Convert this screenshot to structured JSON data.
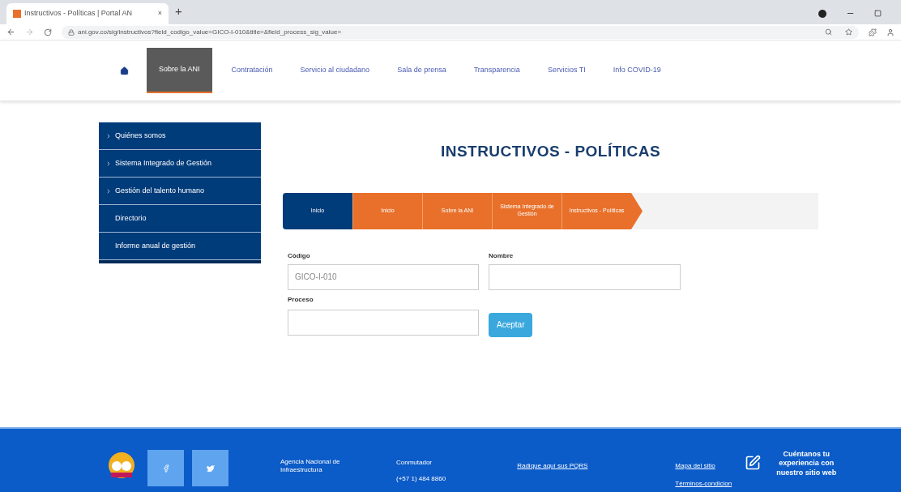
{
  "browser": {
    "tab_title": "Instructivos - Políticas | Portal AN",
    "tab_close": "×",
    "new_tab": "+",
    "url": "ani.gov.co/sig/instructivos?field_codigo_value=GICO-I-010&title=&field_process_sig_value="
  },
  "nav": [
    {
      "label": "Sobre la ANI",
      "selected": true
    },
    {
      "label": "Contratación",
      "selected": false
    },
    {
      "label": "Servicio al ciudadano",
      "selected": false
    },
    {
      "label": "Sala de prensa",
      "selected": false
    },
    {
      "label": "Transparencia",
      "selected": false
    },
    {
      "label": "Servicios TI",
      "selected": false
    },
    {
      "label": "Info COVID-19",
      "selected": false
    }
  ],
  "sidebar": [
    {
      "label": "Quiénes somos",
      "expandable": true
    },
    {
      "label": "Sistema Integrado de Gestión",
      "expandable": true
    },
    {
      "label": "Gestión del talento humano",
      "expandable": true
    },
    {
      "label": "Directorio",
      "expandable": false
    },
    {
      "label": "Informe anual de gestión",
      "expandable": false
    }
  ],
  "title": "INSTRUCTIVOS - POLÍTICAS",
  "breadcrumb": [
    {
      "label": "Inicio",
      "kind": "home"
    },
    {
      "label": "Inicio",
      "kind": "step"
    },
    {
      "label": "Sobre la ANI",
      "kind": "step"
    },
    {
      "label": "Sistema Integrado de Gestión",
      "kind": "step"
    },
    {
      "label": "Instructivos - Políticas",
      "kind": "step"
    }
  ],
  "form": {
    "codigo_label": "Código",
    "codigo_value": "GICO-I-010",
    "nombre_label": "Nombre",
    "proceso_label": "Proceso",
    "submit": "Aceptar"
  },
  "footer": {
    "agency": "Agencia Nacional de Infraestructura",
    "phone_label": "Conmutador",
    "phone": "(+57 1) 484 8860",
    "pqrs": "Radique aquí sus PQRS",
    "sitemap": "Mapa del sitio",
    "terms": "Términos-condicion",
    "feedback": "Cuéntanos tu experiencia con nuestro sitio web"
  }
}
